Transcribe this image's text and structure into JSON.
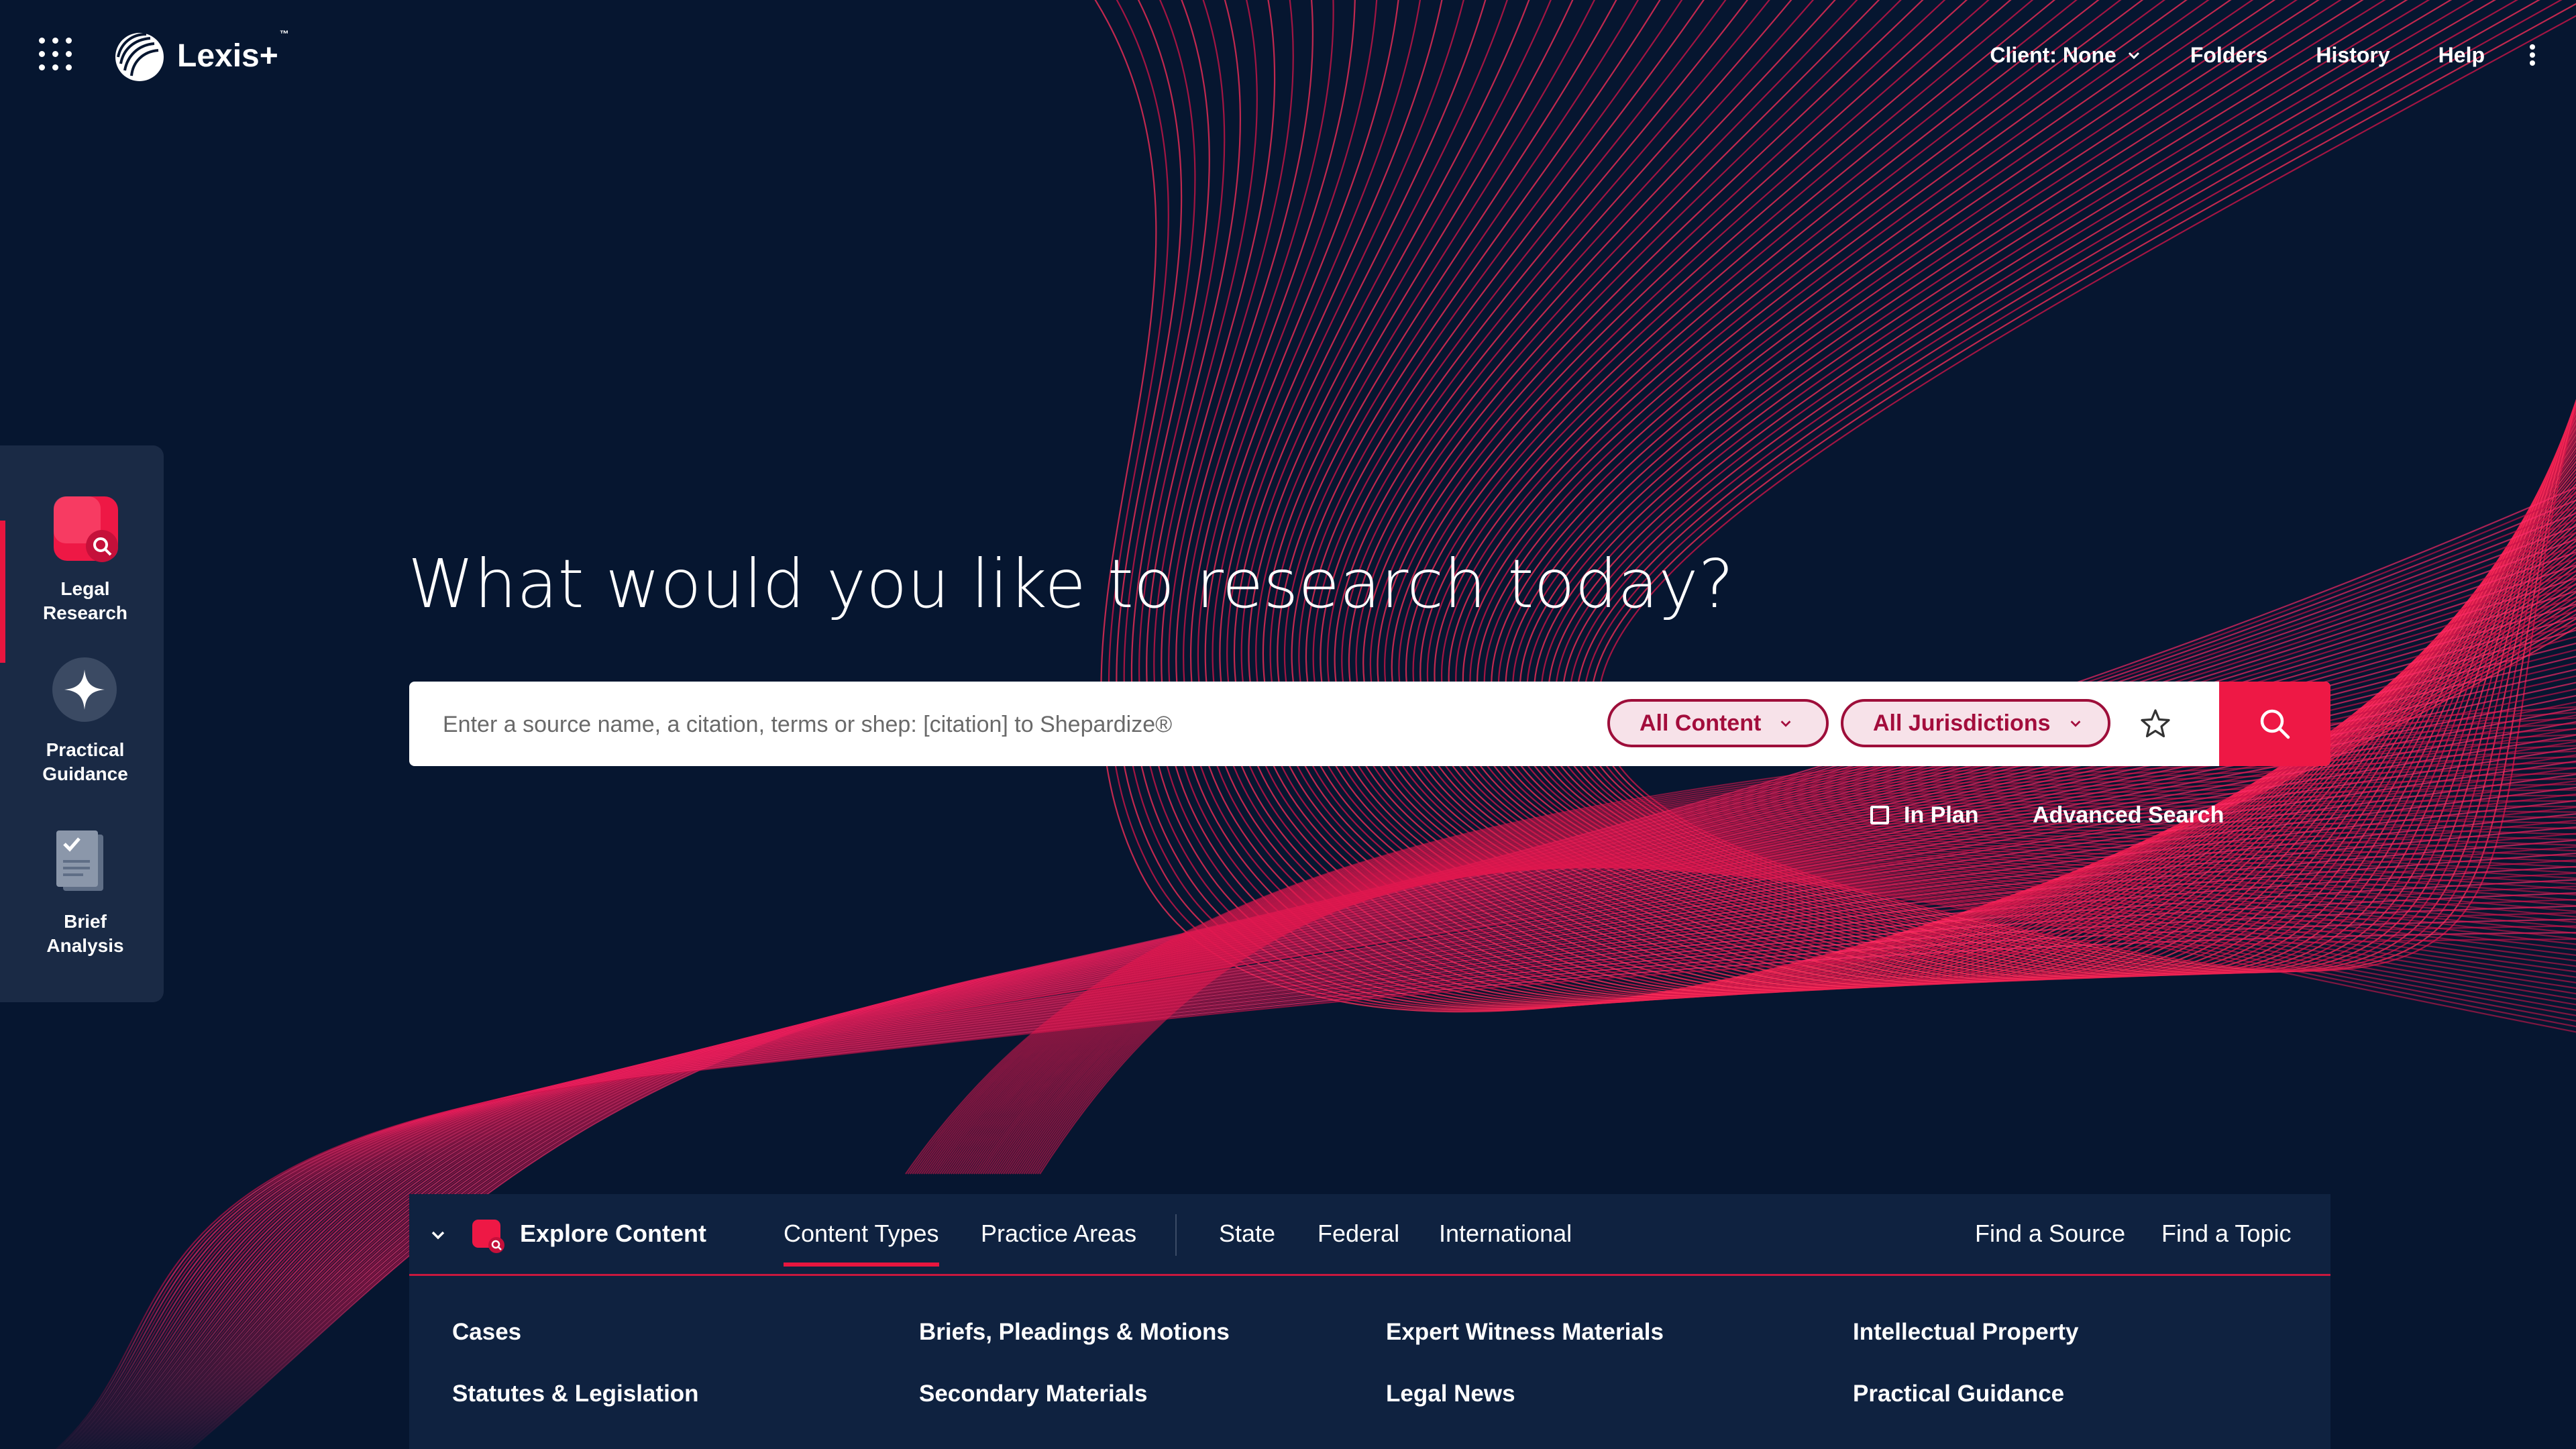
{
  "app": {
    "name": "Lexis+",
    "trademark": "™"
  },
  "topnav": {
    "client_label": "Client: None",
    "folders": "Folders",
    "history": "History",
    "help": "Help"
  },
  "rail": {
    "items": [
      {
        "label_line1": "Legal",
        "label_line2": "Research",
        "active": true
      },
      {
        "label_line1": "Practical",
        "label_line2": "Guidance",
        "active": false
      },
      {
        "label_line1": "Brief",
        "label_line2": "Analysis",
        "active": false
      }
    ]
  },
  "hero": {
    "title": "What would you like to research today?"
  },
  "search": {
    "placeholder": "Enter a source name, a citation, terms or shep: [citation] to Shepardize®",
    "content_filter": "All Content",
    "jurisdiction_filter": "All Jurisdictions",
    "in_plan": "In Plan",
    "in_plan_checked": false,
    "advanced": "Advanced Search"
  },
  "explore": {
    "title": "Explore Content",
    "tabs": [
      "Content Types",
      "Practice Areas",
      "State",
      "Federal",
      "International"
    ],
    "active_tab": "Content Types",
    "find_source": "Find a Source",
    "find_topic": "Find a Topic",
    "links": [
      "Cases",
      "Briefs, Pleadings & Motions",
      "Expert Witness Materials",
      "Intellectual Property",
      "Statutes & Legislation",
      "Secondary Materials",
      "Legal News",
      "Practical Guidance"
    ]
  },
  "colors": {
    "background": "#061630",
    "accent_red": "#ee1845",
    "pill_border": "#9e0e3a",
    "pill_fill": "#f7e2e9",
    "rail_bg": "#1a2a45",
    "panel_bg": "#0f2240"
  },
  "icons": [
    "app-grid-icon",
    "lexis-logo",
    "chevron-down-icon",
    "more-vert-icon",
    "legal-research-icon",
    "practical-guidance-icon",
    "brief-analysis-icon",
    "star-icon",
    "search-icon",
    "explore-content-icon"
  ]
}
